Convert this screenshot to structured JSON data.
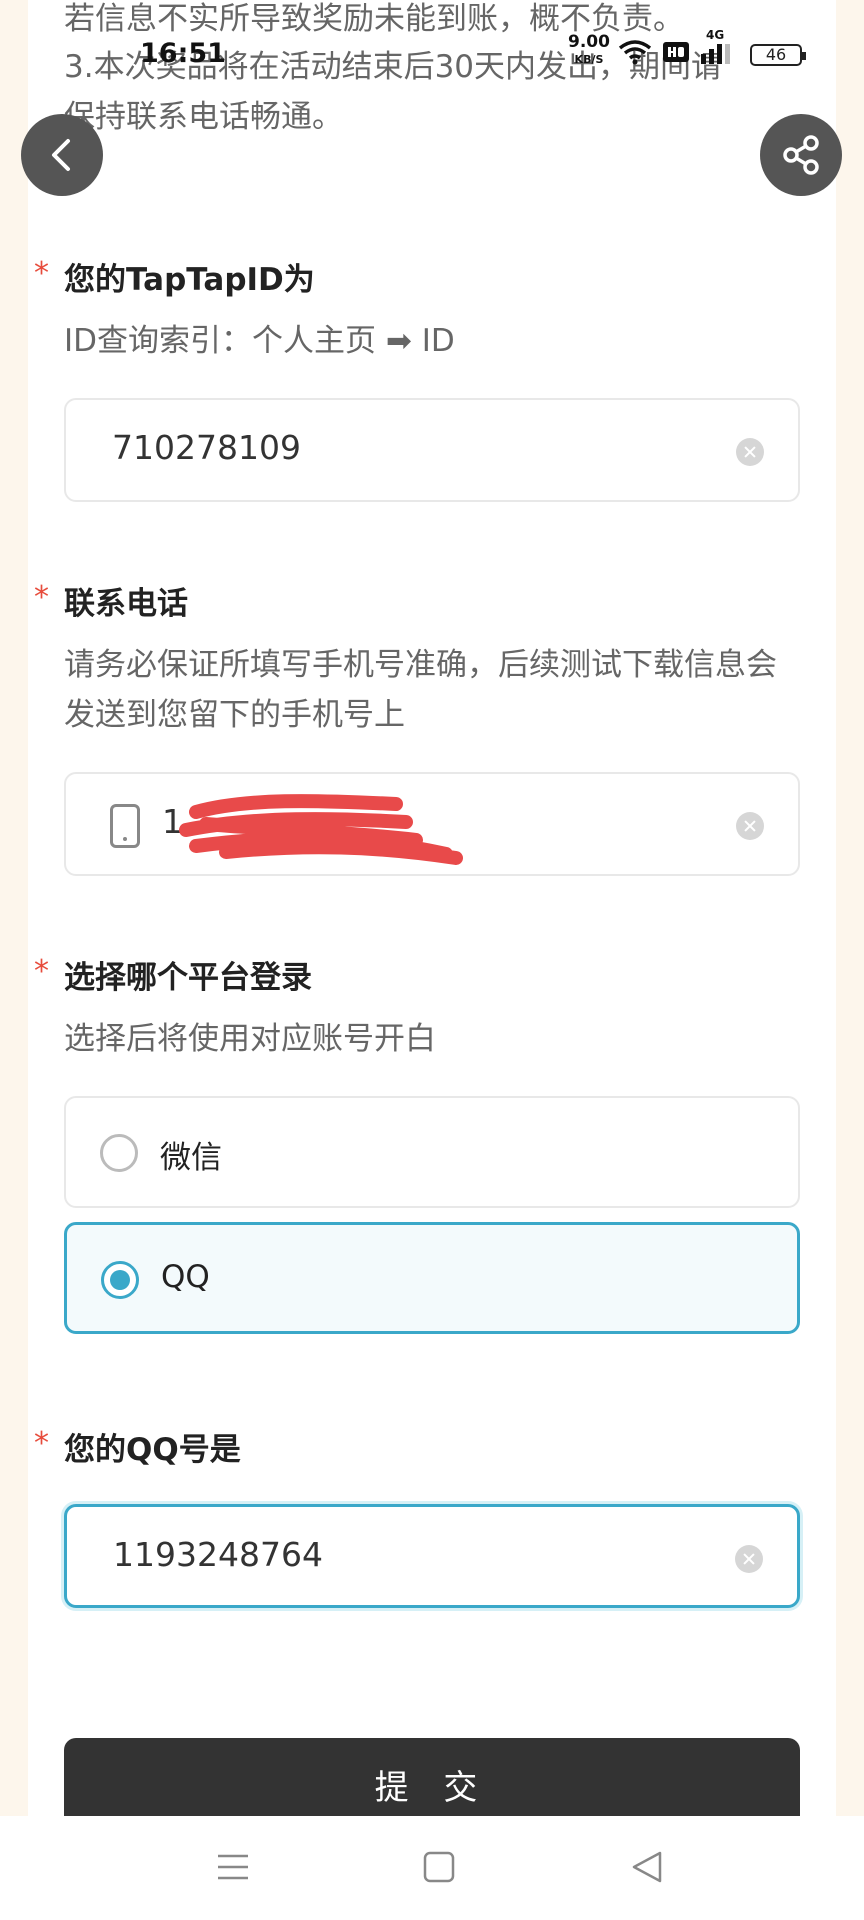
{
  "status_bar": {
    "time": "16:51",
    "speed_value": "9.00",
    "speed_unit": "KB/S",
    "network": "4G",
    "battery": "46"
  },
  "notice": {
    "line1": "若信息不实所导致奖励未能到账，概不负责。",
    "line2": "3.本次奖品将在活动结束后30天内发出，期间请",
    "line3": "保持联系电话畅通。"
  },
  "form": {
    "required_mark": "*",
    "taptap": {
      "label": "您的TapTapID为",
      "hint": "ID查询索引：个人主页 ➡ ID",
      "value": "710278109"
    },
    "phone": {
      "label": "联系电话",
      "hint": "请务必保证所填写手机号准确，后续测试下载信息会发送到您留下的手机号上",
      "value": "1"
    },
    "platform": {
      "label": "选择哪个平台登录",
      "hint": "选择后将使用对应账号开白",
      "options": [
        {
          "label": "微信",
          "selected": false
        },
        {
          "label": "QQ",
          "selected": true
        }
      ]
    },
    "qq": {
      "label": "您的QQ号是",
      "value": "1193248764"
    },
    "submit_label": "提 交"
  },
  "colors": {
    "accent": "#3aa8c9",
    "required": "#e74c3c",
    "submit_bg": "#333333",
    "page_bg": "#fdf6ec"
  }
}
